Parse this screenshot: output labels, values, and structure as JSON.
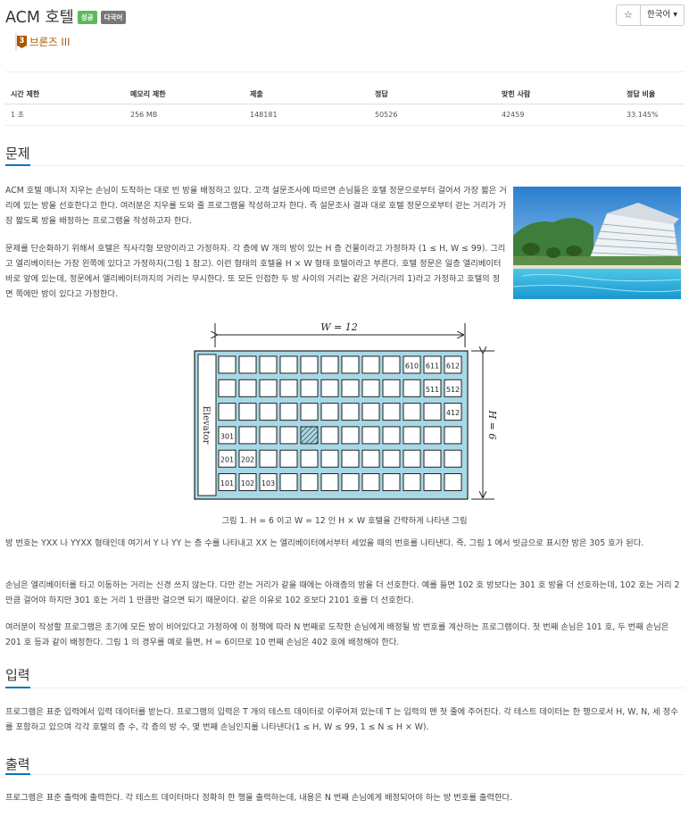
{
  "problem": {
    "title": "ACM 호텔",
    "badges": [
      "성공",
      "다국어"
    ],
    "tier_number": "3",
    "tier": "브론즈 III"
  },
  "toolbar": {
    "star": "☆",
    "language": "한국어 ▾"
  },
  "stats": {
    "headers": [
      "시간 제한",
      "메모리 제한",
      "제출",
      "정답",
      "맞힌 사람",
      "정답 비율"
    ],
    "values": [
      "1 초",
      "256 MB",
      "148181",
      "50526",
      "42459",
      "33.145%"
    ]
  },
  "sections": {
    "problem": "문제",
    "input": "입력",
    "output": "출력"
  },
  "description": [
    "ACM 호텔 매니저 지우는 손님이 도착하는 대로 빈 방을 배정하고 있다. 고객 설문조사에 따르면 손님들은 호텔 정문으로부터 걸어서 가장 짧은 거리에 있는 방을 선호한다고 한다. 여러분은 지우를 도와 줄 프로그램을 작성하고자 한다. 즉 설문조사 결과 대로 호텔 정문으로부터 걷는 거리가 가장 짧도록 방을 배정하는 프로그램을 작성하고자 한다.",
    "문제를 단순화하기 위해서 호텔은 직사각형 모양이라고 가정하자. 각 층에 W 개의 방이 있는 H 층 건물이라고 가정하자 (1 ≤ H, W ≤ 99). 그리고 엘리베이터는 가장 왼쪽에 있다고 가정하자(그림 1 참고). 이런 형태의 호텔을 H × W 형태 호텔이라고 부른다. 호텔 정문은 일층 엘리베이터 바로 앞에 있는데, 정문에서 엘리베이터까지의 거리는 무시한다. 또 모든 인접한 두 방 사이의 거리는 같은 거리(거리 1)라고 가정하고 호텔의 정면 쪽에만 방이 있다고 가정한다.",
    "방 번호는 YXX 나 YYXX 형태인데 여기서 Y 나 YY 는 층 수를 나타내고 XX 는 엘리베이터에서부터 세었을 때의 번호를 나타낸다. 즉, 그림 1 에서 빗금으로 표시한 방은 305 호가 된다.",
    "손님은 엘리베이터를 타고 이동하는 거리는 신경 쓰지 않는다. 다만 걷는 거리가 같을 때에는 아래층의 방을 더 선호한다. 예를 들면 102 호 방보다는 301 호 방을 더 선호하는데, 102 호는 거리 2 만큼 걸어야 하지만 301 호는 거리 1 만큼만 걸으면 되기 때문이다. 같은 이유로 102 호보다 2101 호를 더 선호한다.",
    "여러분이 작성할 프로그램은 초기에 모든 방이 비어있다고 가정하에 이 정책에 따라 N 번째로 도착한 손님에게 배정될 방 번호를 계산하는 프로그램이다. 첫 번째 손님은 101 호, 두 번째 손님은 201 호 등과 같이 배정한다. 그림 1 의 경우를 예로 들면, H = 6이므로 10 번째 손님은 402 호에 배정해야 한다."
  ],
  "figure": {
    "width_label": "W = 12",
    "height_label": "H = 6",
    "elevator_label": "Elevator",
    "caption": "그림 1. H = 6 이고 W = 12 인 H × W 호텔을 간략하게 나타낸 그림",
    "floors": 6,
    "rooms_per_floor": 12,
    "room_labels": {
      "r6c10": "610",
      "r6c11": "611",
      "r6c12": "612",
      "r5c11": "511",
      "r5c12": "512",
      "r4c12": "412",
      "r3c1": "301",
      "r2c1": "201",
      "r2c2": "202",
      "r1c1": "101",
      "r1c2": "102",
      "r1c3": "103"
    },
    "hatched_room": "305",
    "colors": {
      "building": "#a8d8e6",
      "room": "#ffffff",
      "stroke": "#222222"
    }
  },
  "input_text": "프로그램은 표준 입력에서 입력 데이터를 받는다. 프로그램의 입력은 T 개의 테스트 데이터로 이루어져 있는데 T 는 입력의 맨 첫 줄에 주어진다. 각 테스트 데이터는 한 행으로서 H, W, N, 세 정수를 포함하고 있으며 각각 호텔의 층 수, 각 층의 방 수, 몇 번째 손님인지를 나타낸다(1 ≤ H, W ≤ 99, 1 ≤ N ≤ H × W).",
  "output_text": "프로그램은 표준 출력에 출력한다. 각 테스트 데이터마다 정확히 한 행을 출력하는데, 내용은 N 번째 손님에게 배정되어야 하는 방 번호를 출력한다.",
  "colors": {
    "accent": "#0076c0",
    "tier": "#ad5600",
    "success": "#5cb85c"
  }
}
